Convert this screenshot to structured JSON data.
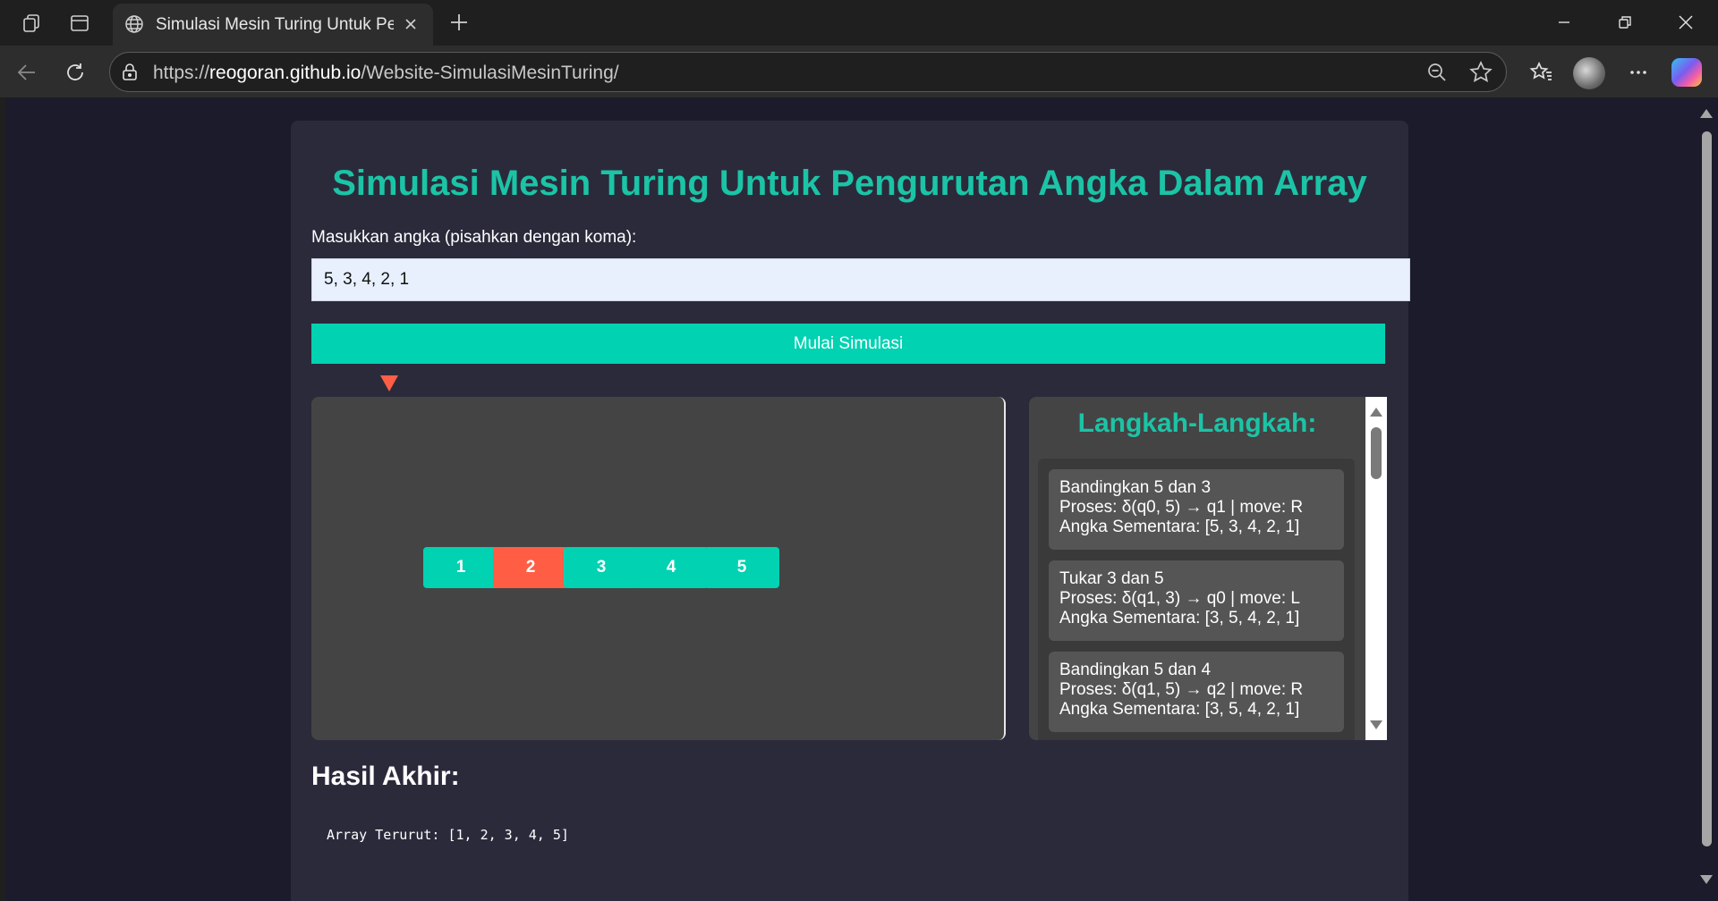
{
  "browser": {
    "tab_title": "Simulasi Mesin Turing Untuk Pengurutan Angka Dalam Array",
    "url_prefix": "https://",
    "url_host": "reogoran.github.io",
    "url_path": "/Website-SimulasiMesinTuring/",
    "icons": [
      "workspaces-icon",
      "tab-actions-icon",
      "globe-icon",
      "close-icon",
      "plus-icon",
      "minimize-icon",
      "restore-icon",
      "window-close-icon",
      "back-icon",
      "refresh-icon",
      "lock-icon",
      "zoom-out-icon",
      "star-icon",
      "favorites-icon",
      "profile-avatar",
      "more-icon",
      "copilot-icon"
    ]
  },
  "page": {
    "title": "Simulasi Mesin Turing Untuk Pengurutan Angka Dalam Array",
    "input_label": "Masukkan angka (pisahkan dengan koma):",
    "input_value": "5, 3, 4, 2, 1",
    "start_button": "Mulai Simulasi",
    "head_pointer_color": "#ff5e45",
    "tape": {
      "cells": [
        {
          "value": "1",
          "active": false
        },
        {
          "value": "2",
          "active": true
        },
        {
          "value": "3",
          "active": false
        },
        {
          "value": "4",
          "active": false
        },
        {
          "value": "5",
          "active": false
        }
      ],
      "cell_color": "#00d2b2",
      "active_color": "#ff5e45"
    },
    "steps_title": "Langkah-Langkah:",
    "steps": [
      {
        "action": "Bandingkan 5 dan 3",
        "process": "Proses: δ(q0, 5) → q1 | move: R",
        "temp": "Angka Sementara: [5, 3, 4, 2, 1]"
      },
      {
        "action": "Tukar 3 dan 5",
        "process": "Proses: δ(q1, 3) → q0 | move: L",
        "temp": "Angka Sementara: [3, 5, 4, 2, 1]"
      },
      {
        "action": "Bandingkan 5 dan 4",
        "process": "Proses: δ(q1, 5) → q2 | move: R",
        "temp": "Angka Sementara: [3, 5, 4, 2, 1]"
      }
    ],
    "result_title": "Hasil Akhir:",
    "result_text": "Array Terurut: [1, 2, 3, 4, 5]"
  }
}
